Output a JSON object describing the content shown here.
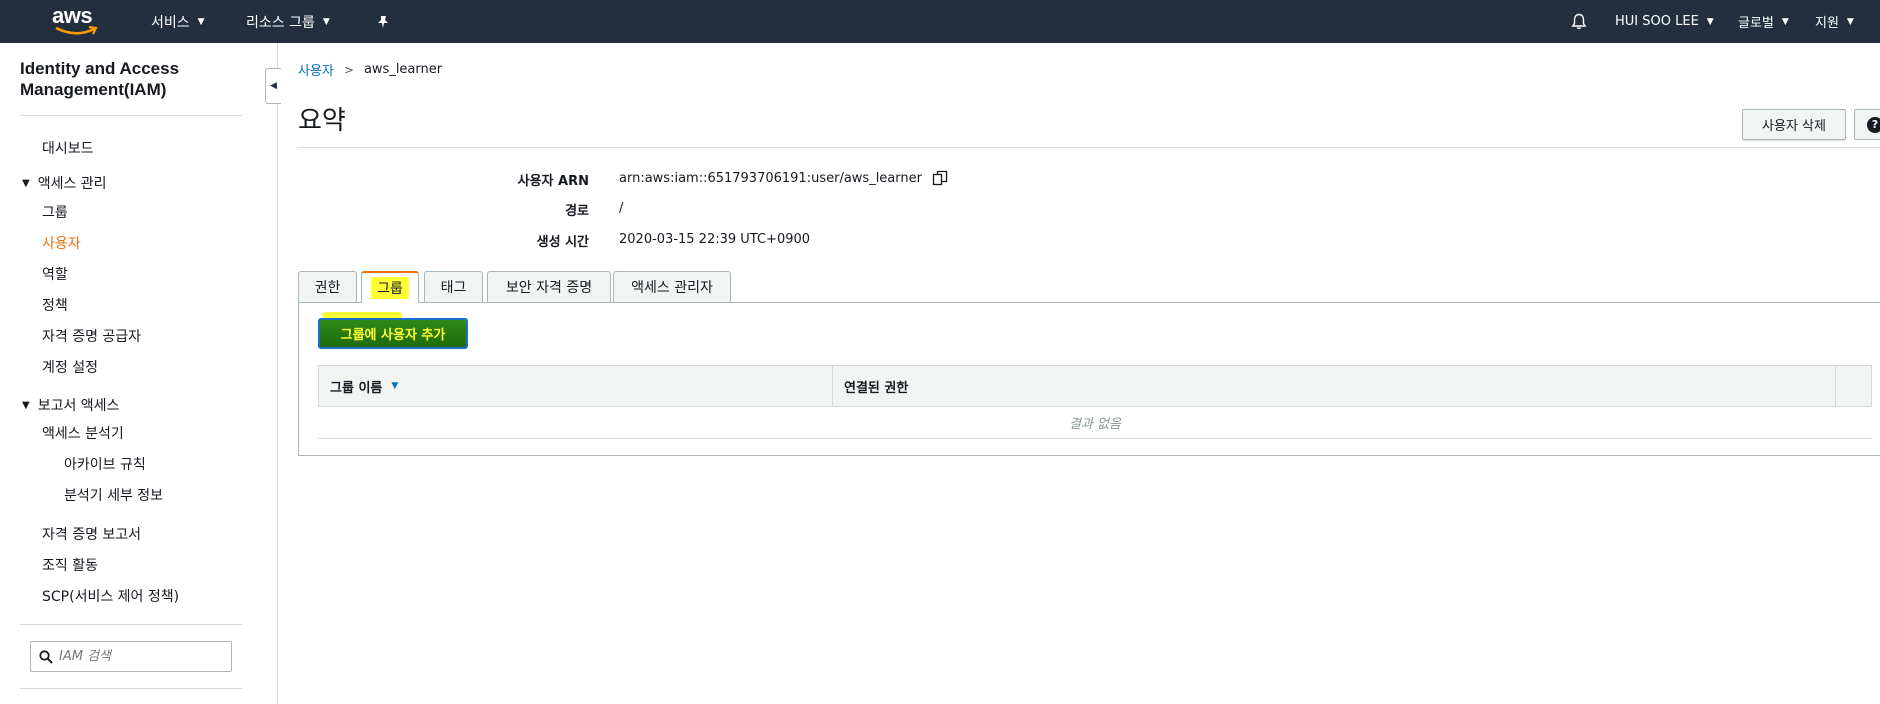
{
  "topnav": {
    "logo_text": "aws",
    "services": "서비스",
    "resource_groups": "리소스 그룹",
    "user": "HUI SOO LEE",
    "region": "글로벌",
    "support": "지원"
  },
  "sidebar": {
    "title": "Identity and Access Management(IAM)",
    "dashboard": "대시보드",
    "access_mgmt": {
      "label": "액세스 관리",
      "items": [
        "그룹",
        "사용자",
        "역할",
        "정책",
        "자격 증명 공급자",
        "계정 설정"
      ]
    },
    "reports": {
      "label": "보고서 액세스",
      "analyzer": "액세스 분석기",
      "analyzer_items": [
        "아카이브 규칙",
        "분석기 세부 정보"
      ],
      "items": [
        "자격 증명 보고서",
        "조직 활동",
        "SCP(서비스 제어 정책)"
      ]
    },
    "search_placeholder": "IAM 검색"
  },
  "breadcrumb": {
    "parent": "사용자",
    "current": "aws_learner"
  },
  "page": {
    "title": "요약",
    "delete_button": "사용자 삭제",
    "help": "?"
  },
  "summary": {
    "arn_label": "사용자 ARN",
    "arn_value": "arn:aws:iam::651793706191:user/aws_learner",
    "path_label": "경로",
    "path_value": "/",
    "created_label": "생성 시간",
    "created_value": "2020-03-15 22:39 UTC+0900"
  },
  "tabs": [
    "권한",
    "그룹",
    "태그",
    "보안 자격 증명",
    "액세스 관리자"
  ],
  "groups_panel": {
    "add_button": "그룹에 사용자 추가",
    "columns": [
      "그룹 이름",
      "연결된 권한"
    ],
    "empty_text": "결과 없음"
  },
  "colors": {
    "nav_bg": "#232f3e",
    "accent": "#ec7211",
    "link": "#0073bb",
    "highlight": "#ffff33"
  }
}
